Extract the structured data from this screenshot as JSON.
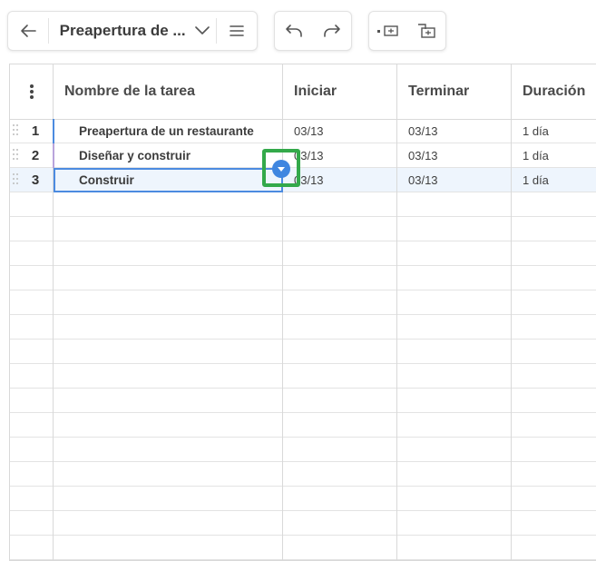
{
  "toolbar": {
    "back_icon": "arrow-left-icon",
    "project_title": "Preapertura de ...",
    "project_dropdown_icon": "chevron-down-icon",
    "menu_icon": "hamburger-menu-icon",
    "undo_icon": "undo-icon",
    "redo_icon": "redo-icon",
    "outdent_icon": "outdent-task-icon",
    "indent_icon": "indent-task-icon"
  },
  "grid": {
    "header_menu_icon": "vertical-ellipsis-icon",
    "columns": [
      "Nombre de la tarea",
      "Iniciar",
      "Terminar",
      "Duración"
    ],
    "rows": [
      {
        "num": "1",
        "name": "Preapertura de un restaurante",
        "start": "03/13",
        "end": "03/13",
        "duration": "1 día"
      },
      {
        "num": "2",
        "name": "Diseñar y construir",
        "start": "03/13",
        "end": "03/13",
        "duration": "1 día"
      },
      {
        "num": "3",
        "name": "Construir",
        "start": "03/13",
        "end": "03/13",
        "duration": "1 día"
      }
    ],
    "selected_row": 3,
    "empty_rows": 15,
    "dropdown_button_icon": "dropdown-caret-icon"
  },
  "colors": {
    "accent_blue": "#4c8be0",
    "highlight_green": "#33a94a",
    "selected_row_bg": "#eef5fd",
    "row2_accent": "#b9a4dc"
  }
}
